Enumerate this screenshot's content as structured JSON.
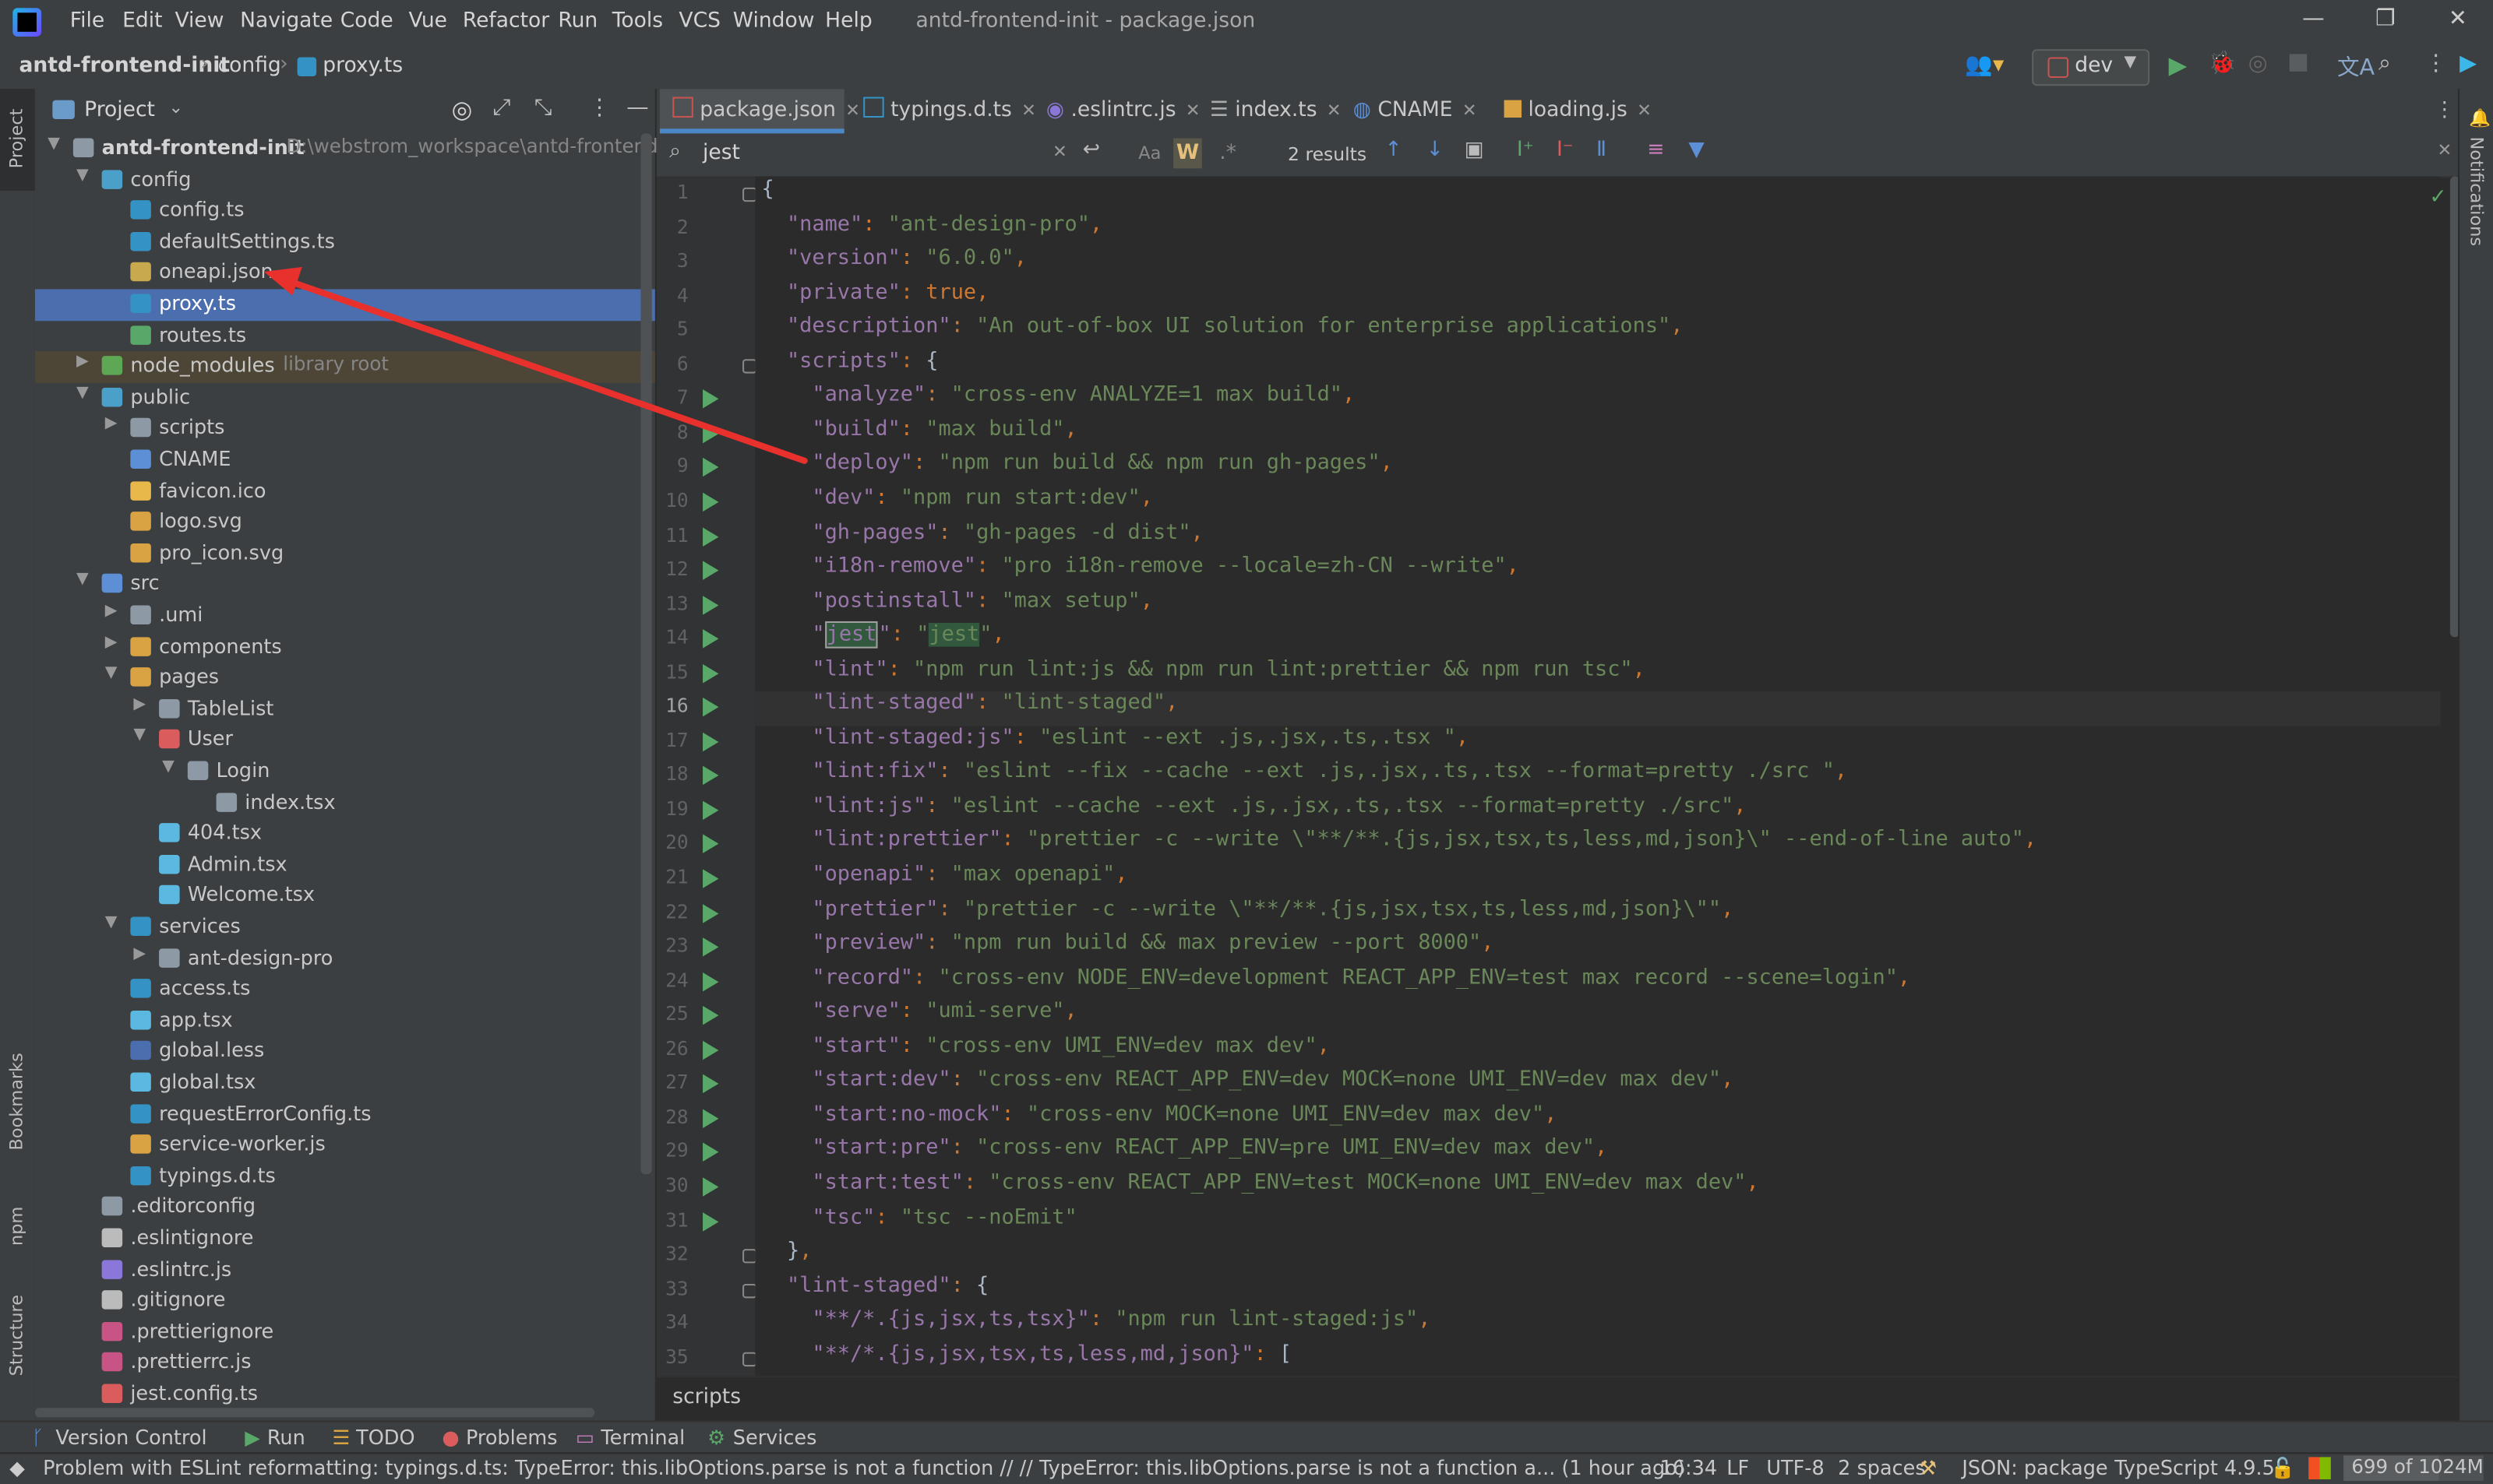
{
  "window": {
    "title": "antd-frontend-init - package.json"
  },
  "menu": [
    "File",
    "Edit",
    "View",
    "Navigate",
    "Code",
    "Vue",
    "Refactor",
    "Run",
    "Tools",
    "VCS",
    "Window",
    "Help"
  ],
  "breadcrumb": {
    "project": "antd-frontend-init",
    "folder": "config",
    "file": "proxy.ts"
  },
  "run_config": {
    "name": "dev"
  },
  "left_stripe": {
    "top": "Project",
    "bookmarks": "Bookmarks",
    "npm": "npm",
    "structure": "Structure"
  },
  "right_stripe": {
    "notifications": "Notifications"
  },
  "project_panel": {
    "title": "Project",
    "root": {
      "name": "antd-frontend-init",
      "path": "D:\\webstrom_workspace\\antd-frontend-ir"
    },
    "items": [
      {
        "label": "config",
        "extra": ""
      },
      {
        "label": "config.ts",
        "extra": ""
      },
      {
        "label": "defaultSettings.ts",
        "extra": ""
      },
      {
        "label": "oneapi.json",
        "extra": ""
      },
      {
        "label": "proxy.ts",
        "extra": ""
      },
      {
        "label": "routes.ts",
        "extra": ""
      },
      {
        "label": "node_modules",
        "extra": "library root"
      },
      {
        "label": "public",
        "extra": ""
      },
      {
        "label": "scripts",
        "extra": ""
      },
      {
        "label": "CNAME",
        "extra": ""
      },
      {
        "label": "favicon.ico",
        "extra": ""
      },
      {
        "label": "logo.svg",
        "extra": ""
      },
      {
        "label": "pro_icon.svg",
        "extra": ""
      },
      {
        "label": "src",
        "extra": ""
      },
      {
        "label": ".umi",
        "extra": ""
      },
      {
        "label": "components",
        "extra": ""
      },
      {
        "label": "pages",
        "extra": ""
      },
      {
        "label": "TableList",
        "extra": ""
      },
      {
        "label": "User",
        "extra": ""
      },
      {
        "label": "Login",
        "extra": ""
      },
      {
        "label": "index.tsx",
        "extra": ""
      },
      {
        "label": "404.tsx",
        "extra": ""
      },
      {
        "label": "Admin.tsx",
        "extra": ""
      },
      {
        "label": "Welcome.tsx",
        "extra": ""
      },
      {
        "label": "services",
        "extra": ""
      },
      {
        "label": "ant-design-pro",
        "extra": ""
      },
      {
        "label": "access.ts",
        "extra": ""
      },
      {
        "label": "app.tsx",
        "extra": ""
      },
      {
        "label": "global.less",
        "extra": ""
      },
      {
        "label": "global.tsx",
        "extra": ""
      },
      {
        "label": "requestErrorConfig.ts",
        "extra": ""
      },
      {
        "label": "service-worker.js",
        "extra": ""
      },
      {
        "label": "typings.d.ts",
        "extra": ""
      },
      {
        "label": ".editorconfig",
        "extra": ""
      },
      {
        "label": ".eslintignore",
        "extra": ""
      },
      {
        "label": ".eslintrc.js",
        "extra": ""
      },
      {
        "label": ".gitignore",
        "extra": ""
      },
      {
        "label": ".prettierignore",
        "extra": ""
      },
      {
        "label": ".prettierrc.js",
        "extra": ""
      },
      {
        "label": "jest.config.ts",
        "extra": ""
      }
    ]
  },
  "tabs": [
    "package.json",
    "typings.d.ts",
    ".eslintrc.js",
    "index.ts",
    "CNAME",
    "loading.js"
  ],
  "find": {
    "query": "jest",
    "results": "2 results",
    "case": "Aa",
    "word": "W"
  },
  "code_lines": [
    {
      "n": "1",
      "t": "{"
    },
    {
      "n": "2",
      "t": "  \"name\": \"ant-design-pro\","
    },
    {
      "n": "3",
      "t": "  \"version\": \"6.0.0\","
    },
    {
      "n": "4",
      "t": "  \"private\": true,"
    },
    {
      "n": "5",
      "t": "  \"description\": \"An out-of-box UI solution for enterprise applications\","
    },
    {
      "n": "6",
      "t": "  \"scripts\": {"
    },
    {
      "n": "7",
      "t": "    \"analyze\": \"cross-env ANALYZE=1 max build\","
    },
    {
      "n": "8",
      "t": "    \"build\": \"max build\","
    },
    {
      "n": "9",
      "t": "    \"deploy\": \"npm run build && npm run gh-pages\","
    },
    {
      "n": "10",
      "t": "    \"dev\": \"npm run start:dev\","
    },
    {
      "n": "11",
      "t": "    \"gh-pages\": \"gh-pages -d dist\","
    },
    {
      "n": "12",
      "t": "    \"i18n-remove\": \"pro i18n-remove --locale=zh-CN --write\","
    },
    {
      "n": "13",
      "t": "    \"postinstall\": \"max setup\","
    },
    {
      "n": "14",
      "t": "    \"jest\": \"jest\","
    },
    {
      "n": "15",
      "t": "    \"lint\": \"npm run lint:js && npm run lint:prettier && npm run tsc\","
    },
    {
      "n": "16",
      "t": "    \"lint-staged\": \"lint-staged\","
    },
    {
      "n": "17",
      "t": "    \"lint-staged:js\": \"eslint --ext .js,.jsx,.ts,.tsx \","
    },
    {
      "n": "18",
      "t": "    \"lint:fix\": \"eslint --fix --cache --ext .js,.jsx,.ts,.tsx --format=pretty ./src \","
    },
    {
      "n": "19",
      "t": "    \"lint:js\": \"eslint --cache --ext .js,.jsx,.ts,.tsx --format=pretty ./src\","
    },
    {
      "n": "20",
      "t": "    \"lint:prettier\": \"prettier -c --write \\\"**/**.{js,jsx,tsx,ts,less,md,json}\\\" --end-of-line auto\","
    },
    {
      "n": "21",
      "t": "    \"openapi\": \"max openapi\","
    },
    {
      "n": "22",
      "t": "    \"prettier\": \"prettier -c --write \\\"**/**.{js,jsx,tsx,ts,less,md,json}\\\"\","
    },
    {
      "n": "23",
      "t": "    \"preview\": \"npm run build && max preview --port 8000\","
    },
    {
      "n": "24",
      "t": "    \"record\": \"cross-env NODE_ENV=development REACT_APP_ENV=test max record --scene=login\","
    },
    {
      "n": "25",
      "t": "    \"serve\": \"umi-serve\","
    },
    {
      "n": "26",
      "t": "    \"start\": \"cross-env UMI_ENV=dev max dev\","
    },
    {
      "n": "27",
      "t": "    \"start:dev\": \"cross-env REACT_APP_ENV=dev MOCK=none UMI_ENV=dev max dev\","
    },
    {
      "n": "28",
      "t": "    \"start:no-mock\": \"cross-env MOCK=none UMI_ENV=dev max dev\","
    },
    {
      "n": "29",
      "t": "    \"start:pre\": \"cross-env REACT_APP_ENV=pre UMI_ENV=dev max dev\","
    },
    {
      "n": "30",
      "t": "    \"start:test\": \"cross-env REACT_APP_ENV=test MOCK=none UMI_ENV=dev max dev\","
    },
    {
      "n": "31",
      "t": "    \"tsc\": \"tsc --noEmit\""
    },
    {
      "n": "32",
      "t": "  },"
    },
    {
      "n": "33",
      "t": "  \"lint-staged\": {"
    },
    {
      "n": "34",
      "t": "    \"**/*.{js,jsx,ts,tsx}\": \"npm run lint-staged:js\","
    },
    {
      "n": "35",
      "t": "    \"**/*.{js,jsx,tsx,ts,less,md,json}\": ["
    }
  ],
  "editor_breadcrumb": "scripts",
  "bottom_tools": [
    "Version Control",
    "Run",
    "TODO",
    "Problems",
    "Terminal",
    "Services"
  ],
  "status": {
    "message": "Problem with ESLint reformatting: typings.d.ts: TypeError: this.libOptions.parse is not a function // // TypeError: this.libOptions.parse is not a function     a... (1 hour ago)",
    "position": "16:34",
    "line_sep": "LF",
    "encoding": "UTF-8",
    "indent": "2 spaces",
    "schema": "JSON: package",
    "ts_version": "TypeScript 4.9.5",
    "memory": "699 of 1024M"
  }
}
